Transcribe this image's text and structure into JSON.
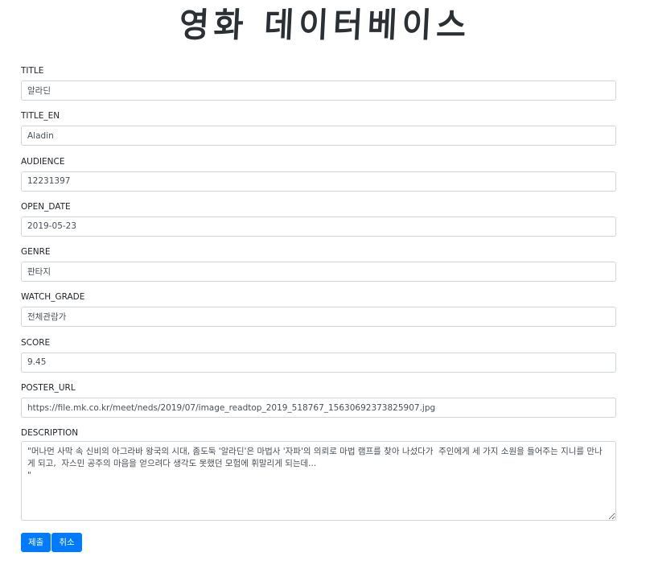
{
  "page": {
    "title": "영화 데이터베이스"
  },
  "form": {
    "fields": [
      {
        "label": "TITLE",
        "value": "알라딘"
      },
      {
        "label": "TITLE_EN",
        "value": "Aladin"
      },
      {
        "label": "AUDIENCE",
        "value": "12231397"
      },
      {
        "label": "OPEN_DATE",
        "value": "2019-05-23"
      },
      {
        "label": "GENRE",
        "value": "판타지"
      },
      {
        "label": "WATCH_GRADE",
        "value": "전체관람가"
      },
      {
        "label": "SCORE",
        "value": "9.45"
      },
      {
        "label": "POSTER_URL",
        "value": "https://file.mk.co.kr/meet/neds/2019/07/image_readtop_2019_518767_15630692373825907.jpg"
      }
    ],
    "description": {
      "label": "DESCRIPTION",
      "value": "\"머나먼 사막 속 신비의 아그라바 왕국의 시대, 좀도둑 '알라딘'은 마법사 '자파'의 의뢰로 마법 램프를 찾아 나섰다가  주인에게 세 가지 소원을 들어주는 지니를 만나게 되고,  자스민 공주의 마음을 얻으려다 생각도 못했던 모험에 휘말리게 되는데...\n\""
    }
  },
  "buttons": {
    "submit_label": "제출",
    "cancel_label": "취소"
  },
  "colors": {
    "primary": "#007bff",
    "border": "#ced4da",
    "text": "#212529"
  }
}
